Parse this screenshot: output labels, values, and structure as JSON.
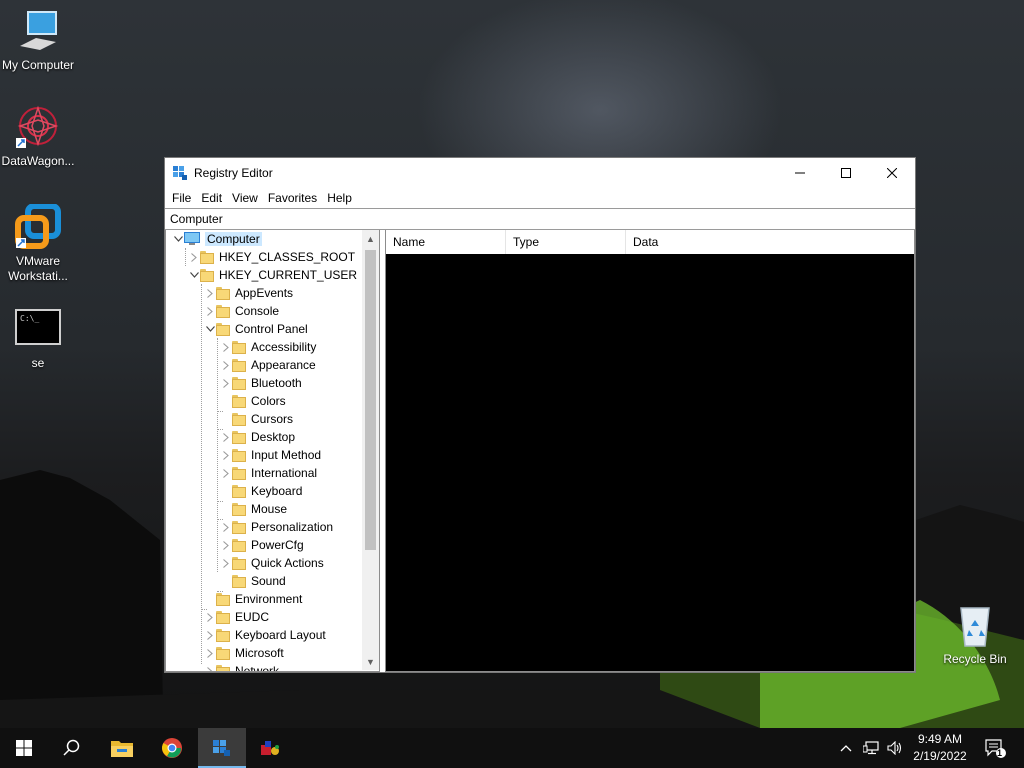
{
  "desktop": {
    "icons": [
      {
        "label": "My Computer"
      },
      {
        "label": "DataWagon..."
      },
      {
        "label": "VMware Workstati..."
      },
      {
        "label": "se"
      },
      {
        "label": "Recycle Bin"
      }
    ]
  },
  "window": {
    "title": "Registry Editor",
    "menu": [
      "File",
      "Edit",
      "View",
      "Favorites",
      "Help"
    ],
    "address": "Computer",
    "tree": [
      {
        "label": "Computer",
        "depth": 0,
        "expanded": true,
        "selected": true
      },
      {
        "label": "HKEY_CLASSES_ROOT",
        "depth": 1,
        "expanded": false
      },
      {
        "label": "HKEY_CURRENT_USER",
        "depth": 1,
        "expanded": true
      },
      {
        "label": "AppEvents",
        "depth": 2,
        "expanded": false
      },
      {
        "label": "Console",
        "depth": 2,
        "expanded": false
      },
      {
        "label": "Control Panel",
        "depth": 2,
        "expanded": true
      },
      {
        "label": "Accessibility",
        "depth": 3,
        "expanded": false
      },
      {
        "label": "Appearance",
        "depth": 3,
        "expanded": false
      },
      {
        "label": "Bluetooth",
        "depth": 3,
        "expanded": false
      },
      {
        "label": "Colors",
        "depth": 3,
        "leaf": true
      },
      {
        "label": "Cursors",
        "depth": 3,
        "leaf": true
      },
      {
        "label": "Desktop",
        "depth": 3,
        "expanded": false
      },
      {
        "label": "Input Method",
        "depth": 3,
        "expanded": false
      },
      {
        "label": "International",
        "depth": 3,
        "expanded": false
      },
      {
        "label": "Keyboard",
        "depth": 3,
        "leaf": true
      },
      {
        "label": "Mouse",
        "depth": 3,
        "leaf": true
      },
      {
        "label": "Personalization",
        "depth": 3,
        "expanded": false
      },
      {
        "label": "PowerCfg",
        "depth": 3,
        "expanded": false
      },
      {
        "label": "Quick Actions",
        "depth": 3,
        "expanded": false
      },
      {
        "label": "Sound",
        "depth": 3,
        "leaf": true
      },
      {
        "label": "Environment",
        "depth": 2,
        "leaf": true
      },
      {
        "label": "EUDC",
        "depth": 2,
        "expanded": false
      },
      {
        "label": "Keyboard Layout",
        "depth": 2,
        "expanded": false
      },
      {
        "label": "Microsoft",
        "depth": 2,
        "expanded": false
      },
      {
        "label": "Network",
        "depth": 2,
        "expanded": false
      }
    ],
    "columns": [
      "Name",
      "Type",
      "Data"
    ]
  },
  "taskbar": {
    "time": "9:49 AM",
    "date": "2/19/2022",
    "notification_count": "1",
    "active_app": "registry-editor"
  },
  "colors": {
    "selection": "#cce8ff",
    "taskbar": "#101010",
    "accent": "#76b9ed"
  }
}
